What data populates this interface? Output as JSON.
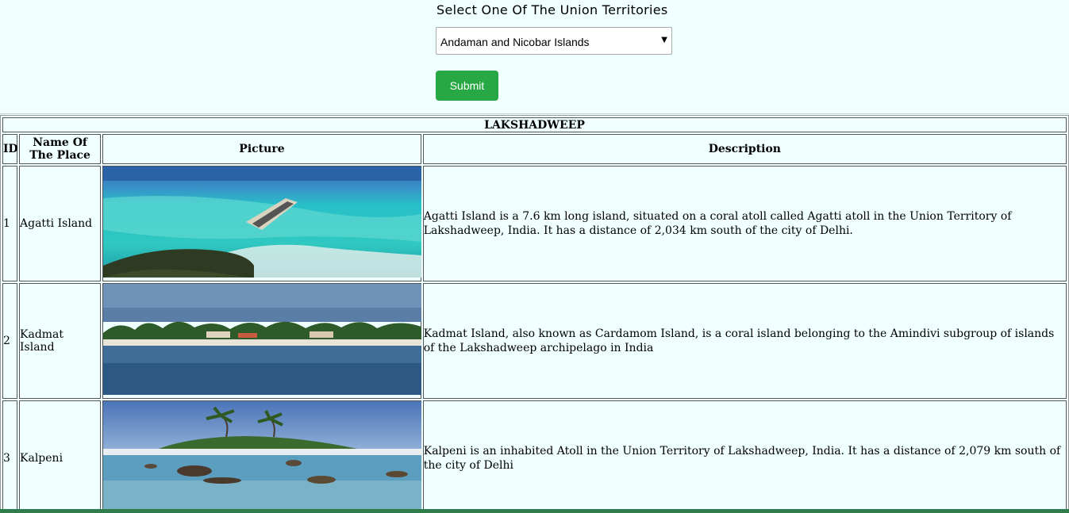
{
  "form": {
    "label": "Select One Of The Union Territories",
    "selected_option": "Andaman and Nicobar Islands",
    "submit_label": "Submit"
  },
  "table": {
    "caption": "LAKSHADWEEP",
    "headers": {
      "id": "ID",
      "name": "Name Of The Place",
      "picture": "Picture",
      "description": "Description"
    },
    "rows": [
      {
        "id": "1",
        "name": "Agatti Island",
        "description": "Agatti Island is a 7.6 km long island, situated on a coral atoll called Agatti atoll in the Union Territory of Lakshadweep, India. It has a distance of 2,034 km south of the city of Delhi."
      },
      {
        "id": "2",
        "name": "Kadmat Island",
        "description": "Kadmat Island, also known as Cardamom Island, is a coral island belonging to the Amindivi subgroup of islands of the Lakshadweep archipelago in India"
      },
      {
        "id": "3",
        "name": "Kalpeni",
        "description": "Kalpeni is an inhabited Atoll in the Union Territory of Lakshadweep, India. It has a distance of 2,079 km south of the city of Delhi"
      }
    ]
  },
  "colors": {
    "page_background": "#f0ffff",
    "submit_button": "#28a745",
    "footer_strip": "#2e7d4a"
  }
}
